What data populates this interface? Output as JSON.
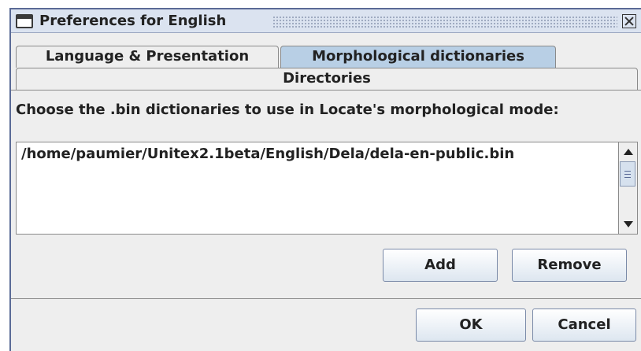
{
  "window": {
    "title": "Preferences for English",
    "icon": "window-icon",
    "close_icon": "close-icon"
  },
  "tabs": [
    {
      "label": "Language & Presentation",
      "selected": false
    },
    {
      "label": "Morphological dictionaries",
      "selected": true
    },
    {
      "label": "Directories",
      "selected": false
    }
  ],
  "panel": {
    "prompt": "Choose the .bin dictionaries to use in Locate's morphological mode:",
    "list": [
      "/home/paumier/Unitex2.1beta/English/Dela/dela-en-public.bin"
    ],
    "add_label": "Add",
    "remove_label": "Remove"
  },
  "footer": {
    "ok_label": "OK",
    "cancel_label": "Cancel"
  },
  "colors": {
    "titlebar": "#dbe3f0",
    "selected_tab": "#b8cfe5",
    "frame_border": "#5a6a96"
  }
}
